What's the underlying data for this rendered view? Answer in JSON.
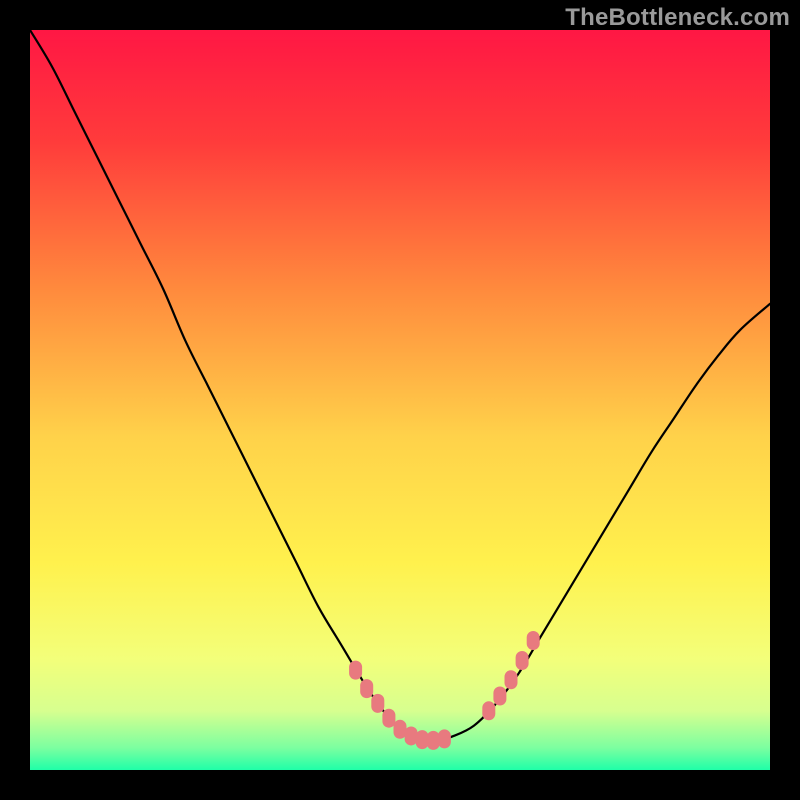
{
  "watermark": "TheBottleneck.com",
  "chart_data": {
    "type": "line",
    "title": "",
    "xlabel": "",
    "ylabel": "",
    "xlim": [
      0,
      100
    ],
    "ylim": [
      0,
      100
    ],
    "grid": false,
    "legend": false,
    "x": [
      0,
      3,
      6,
      9,
      12,
      15,
      18,
      21,
      24,
      27,
      30,
      33,
      36,
      39,
      42,
      45,
      47,
      49,
      51,
      53,
      55,
      57,
      60,
      63,
      66,
      69,
      72,
      75,
      78,
      81,
      84,
      87,
      90,
      93,
      96,
      100
    ],
    "y": [
      100,
      95,
      89,
      83,
      77,
      71,
      65,
      58,
      52,
      46,
      40,
      34,
      28,
      22,
      17,
      12,
      9,
      6.5,
      4.8,
      4,
      4,
      4.5,
      6,
      9,
      13,
      18,
      23,
      28,
      33,
      38,
      43,
      47.5,
      52,
      56,
      59.5,
      63
    ],
    "markers": {
      "x": [
        44,
        45.5,
        47,
        48.5,
        50,
        51.5,
        53,
        54.5,
        56,
        62,
        63.5,
        65,
        66.5,
        68
      ],
      "y": [
        13.5,
        11,
        9,
        7,
        5.5,
        4.6,
        4.1,
        4,
        4.2,
        8,
        10,
        12.2,
        14.8,
        17.5
      ]
    },
    "gradient_stops": [
      {
        "offset": 0,
        "color": "#ff1744"
      },
      {
        "offset": 15,
        "color": "#ff3b3b"
      },
      {
        "offset": 35,
        "color": "#ff8a3d"
      },
      {
        "offset": 55,
        "color": "#ffd24a"
      },
      {
        "offset": 72,
        "color": "#fff14d"
      },
      {
        "offset": 85,
        "color": "#f3ff7a"
      },
      {
        "offset": 92,
        "color": "#d7ff8f"
      },
      {
        "offset": 97,
        "color": "#7cffa0"
      },
      {
        "offset": 100,
        "color": "#1fffa8"
      }
    ],
    "marker_color": "#e87a7f",
    "line_color": "#000000"
  }
}
